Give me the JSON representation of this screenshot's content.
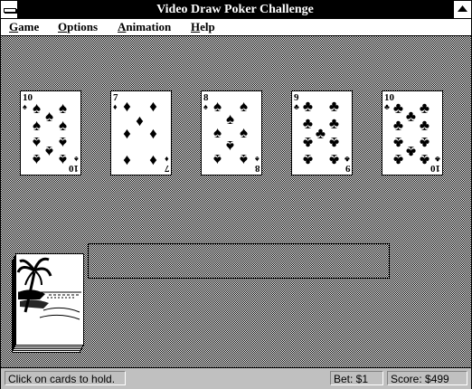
{
  "window": {
    "title": "Video Draw Poker Challenge"
  },
  "menu": [
    {
      "label": "Game",
      "mnemonic": "G",
      "rest": "ame"
    },
    {
      "label": "Options",
      "mnemonic": "O",
      "rest": "ptions"
    },
    {
      "label": "Animation",
      "mnemonic": "A",
      "rest": "nimation"
    },
    {
      "label": "Help",
      "mnemonic": "H",
      "rest": "elp"
    }
  ],
  "hand": [
    {
      "rank": "10",
      "suit": "spades",
      "symbol": "♠"
    },
    {
      "rank": "7",
      "suit": "diamonds",
      "symbol": "♦"
    },
    {
      "rank": "8",
      "suit": "spades",
      "symbol": "♠"
    },
    {
      "rank": "9",
      "suit": "clubs",
      "symbol": "♣"
    },
    {
      "rank": "10",
      "suit": "clubs",
      "symbol": "♣"
    }
  ],
  "deck": {
    "back_design": "palm-tree-beach-icon"
  },
  "status": {
    "message": "Click on cards to hold.",
    "bet": "Bet: $1",
    "score": "Score: $499"
  },
  "colors": {
    "title_bar": "#000000",
    "status_bar": "#c0c0c0",
    "card_ink": "#000000"
  }
}
